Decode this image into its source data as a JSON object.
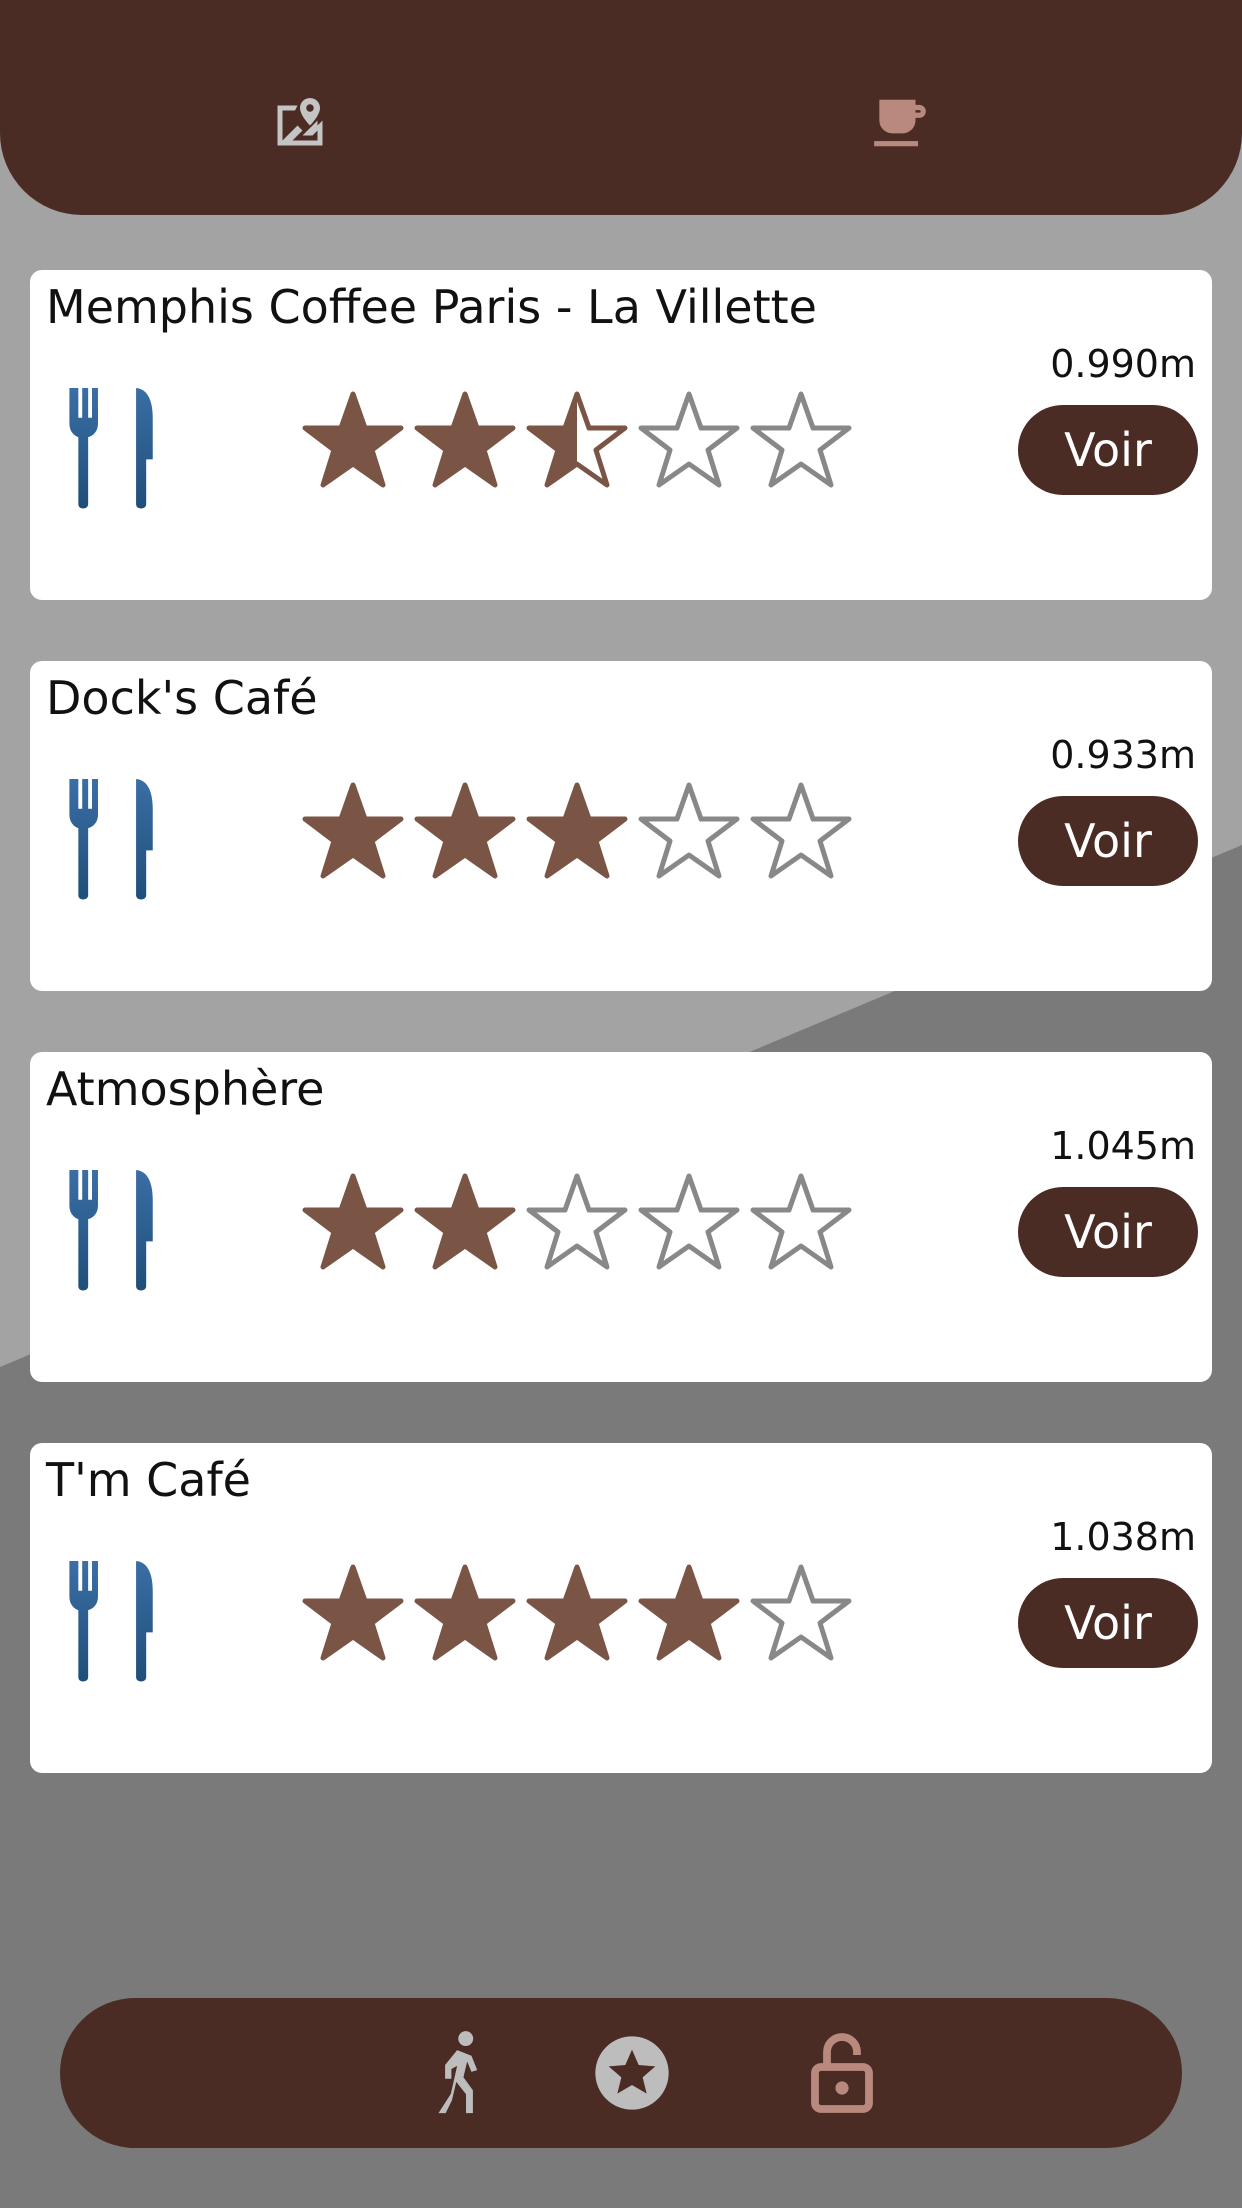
{
  "top_nav": {
    "map_icon": "map-location-icon",
    "cafe_icon": "coffee-cup-icon"
  },
  "places": [
    {
      "name": "Memphis Coffee Paris - La Villette",
      "distance": "0.990m",
      "rating": 2.5,
      "button_label": "Voir",
      "icon": "cutlery-icon"
    },
    {
      "name": "Dock's Café",
      "distance": "0.933m",
      "rating": 3,
      "button_label": "Voir",
      "icon": "cutlery-icon"
    },
    {
      "name": "Atmosphère",
      "distance": "1.045m",
      "rating": 2,
      "button_label": "Voir",
      "icon": "cutlery-icon"
    },
    {
      "name": "T'm Café",
      "distance": "1.038m",
      "rating": 4,
      "button_label": "Voir",
      "icon": "cutlery-icon"
    }
  ],
  "bottom_nav": {
    "items": [
      {
        "icon": "walking-person-icon"
      },
      {
        "icon": "star-circle-icon"
      },
      {
        "icon": "unlock-icon"
      }
    ]
  },
  "colors": {
    "brand_dark": "#4a2c24",
    "star_filled": "#7a5445",
    "star_empty_stroke": "#888888",
    "cutlery": "#1f4e79",
    "top_icon_active": "#b8897c",
    "icon_inactive": "#bdbdbd"
  }
}
